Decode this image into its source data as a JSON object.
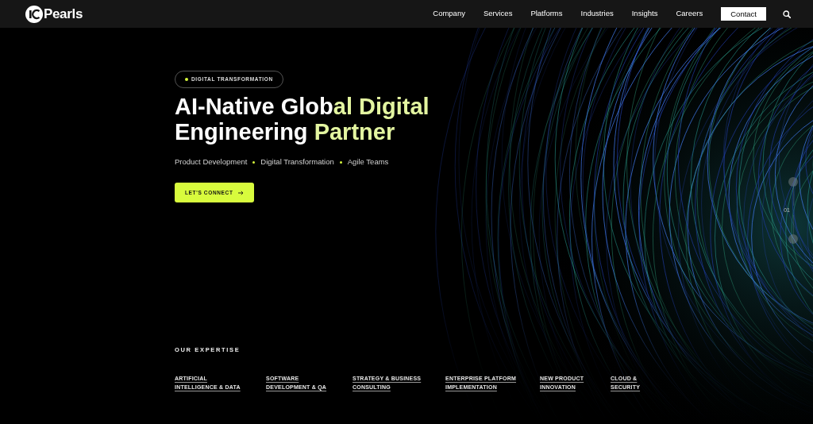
{
  "navbar": {
    "logo_text": "Pearls",
    "links": [
      "Company",
      "Services",
      "Platforms",
      "Industries",
      "Insights",
      "Careers"
    ],
    "contact_button": "Contact"
  },
  "hero": {
    "badge": "DIGITAL TRANSFORMATION",
    "headline": [
      {
        "text": "AI-Native Glob",
        "accent": false
      },
      {
        "text": "al Digital",
        "accent": true
      },
      {
        "text": " Engineering ",
        "accent": false
      },
      {
        "text": "Partner",
        "accent": true
      }
    ],
    "services": [
      "Product Development",
      "Digital Transformation",
      "Agile Teams"
    ],
    "cta_button": "LET'S CONNECT"
  },
  "slider": {
    "counter": "01"
  },
  "expertise": {
    "title": "OUR EXPERTISE",
    "items": [
      {
        "lines": [
          "ARTIFICIAL",
          "INTELLIGENCE & DATA"
        ]
      },
      {
        "lines": [
          "SOFTWARE",
          "DEVELOPMENT & QA"
        ]
      },
      {
        "lines": [
          "STRATEGY & BUSINESS",
          "CONSULTING"
        ]
      },
      {
        "lines": [
          "ENTERPRISE PLATFORM",
          "IMPLEMENTATION"
        ]
      },
      {
        "lines": [
          "NEW PRODUCT",
          "INNOVATION"
        ]
      },
      {
        "lines": [
          "CLOUD &",
          "SECURITY"
        ]
      }
    ]
  }
}
